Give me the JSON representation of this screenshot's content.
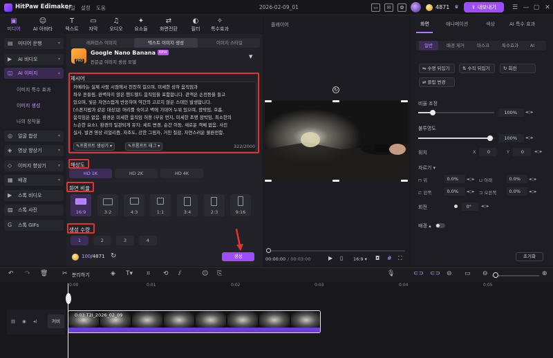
{
  "app": {
    "name": "HitPaw Edimakor",
    "project_name": "2026-02-09_01"
  },
  "menu": [
    "파일",
    "설정",
    "도움"
  ],
  "account": {
    "credits": "4871",
    "export_label": "내보내기"
  },
  "toolbar": [
    {
      "label": "미디어",
      "icon": "media-icon",
      "glyph": "▣"
    },
    {
      "label": "AI 아바타",
      "icon": "avatar-icon",
      "glyph": "☺"
    },
    {
      "label": "텍스트",
      "icon": "text-icon",
      "glyph": "T"
    },
    {
      "label": "자막",
      "icon": "subtitle-icon",
      "glyph": "▭"
    },
    {
      "label": "오디오",
      "icon": "audio-icon",
      "glyph": "♫"
    },
    {
      "label": "요소들",
      "icon": "elements-icon",
      "glyph": "✦"
    },
    {
      "label": "화면전환",
      "icon": "transition-icon",
      "glyph": "⇄"
    },
    {
      "label": "필터",
      "icon": "filter-icon",
      "glyph": "◐"
    },
    {
      "label": "특수효과",
      "icon": "effects-icon",
      "glyph": "✧"
    }
  ],
  "sidebar": {
    "items": [
      {
        "label": "미디어 운행",
        "icon": "folder-icon",
        "glyph": "▤",
        "arrow": "▾"
      },
      {
        "label": "AI 비디오",
        "icon": "ai-video-icon",
        "glyph": "▶",
        "arrow": "▾"
      },
      {
        "label": "AI 이미지",
        "icon": "ai-image-icon",
        "glyph": "◫",
        "arrow": "▴"
      }
    ],
    "subitems": [
      "이미지 특수 효과",
      "이미지 생성",
      "나의 창작물"
    ],
    "items2": [
      {
        "label": "얼굴 합성",
        "icon": "face-swap-icon",
        "glyph": "◎",
        "arrow": "▾"
      },
      {
        "label": "영상 향상기",
        "icon": "video-enhance-icon",
        "glyph": "◈",
        "arrow": "▾"
      },
      {
        "label": "이미지 향상기",
        "icon": "image-enhance-icon",
        "glyph": "◇",
        "arrow": "▾"
      },
      {
        "label": "배경",
        "icon": "background-icon",
        "glyph": "▦",
        "arrow": "▾"
      },
      {
        "label": "스톡 비디오",
        "icon": "stock-video-icon",
        "glyph": "▶"
      },
      {
        "label": "스톡 사진",
        "icon": "stock-photo-icon",
        "glyph": "▨"
      },
      {
        "label": "스톡 GIFs",
        "icon": "gif-icon",
        "glyph": "G"
      }
    ]
  },
  "gen_tabs": [
    "레퍼런스 이미지",
    "텍스트 이미지 생성",
    "이미지 스타일"
  ],
  "model": {
    "name": "Google Nano Banana Pro",
    "badge": "NEW",
    "desc": "전문급 이미지 생성 모델",
    "pro": "PRO"
  },
  "prompt": {
    "label": "제시어",
    "text": "카메라는 실제 사람 시점에서 천천히 걸으며, 미세한 상하 움직임과\n좌우 흔들림, 완벽하지 않은 핸드헬드 움직임을 포함합니다. 관객은 손전등을 들고\n있으며, 빛은 자연스럽게 반응하며 약간의 고르지 않은 스테인 발생합니다.\n[스폰지밥과 같은 대상]은 머리를 숙이고 벽에 기대어 누워 있으며, 깜박임, 호흡,\n움직임은 없음. 환경은 미세한 움직임 허용 (부유 먼지, 미세한 조명 깜박임, 최소한의\n느슨한 요소). 환경의 일관되게 유지: 세트 변경, 순간 이동, 새로운 객체 없음. 사진\n실사, 발견 영상 리얼리즘, 자조도, 강한 그림자, 거친 질감, 자연스러운 불완전함.",
    "chip1": "프롬프트 생성기 ▾",
    "chip2": "프롬프트 태그 ▾",
    "counter": "322/2000"
  },
  "resolution": {
    "label": "해상도",
    "options": [
      "HD 1K",
      "HD 2K",
      "HD 4K"
    ]
  },
  "aspect": {
    "label": "화면 비율",
    "options": [
      "16:9",
      "3:2",
      "4:3",
      "1:1",
      "3:4",
      "2:3",
      "9:16"
    ]
  },
  "count": {
    "label": "생성 수량",
    "options": [
      "1",
      "2",
      "3",
      "4"
    ]
  },
  "bottom": {
    "credit_used": "100",
    "credit_total": "/4871",
    "generate_label": "생성"
  },
  "player": {
    "title": "플레이어",
    "time_current": "00:00:00",
    "time_total": "/ 00:03:00",
    "ratio": "16:9 ▾"
  },
  "props": {
    "tabs": [
      "화면",
      "애니메이션",
      "색상",
      "AI 특수 효과"
    ],
    "subtabs": [
      "일반",
      "배경 제거",
      "마스크",
      "특수효과",
      "AI"
    ],
    "flip_h": "수평 뒤집기",
    "flip_v": "수직 뒤집기",
    "rotate": "회전",
    "clip_change": "클립 변경",
    "scale_label": "비율 조정",
    "scale_value": "100%",
    "opacity_label": "불투명도",
    "opacity_value": "100%",
    "position_label": "위치",
    "pos_x_label": "X",
    "pos_x": "0",
    "pos_y_label": "Y",
    "pos_y": "0",
    "crop_label": "자르기 ▾",
    "crop_top": "위",
    "crop_bottom": "아래",
    "crop_left": "왼쪽",
    "crop_right": "오른쪽",
    "crop_val": "0.0%",
    "rotation_label": "회전",
    "rotation_value": "0°",
    "bg_label": "배경 ▴",
    "reset": "초기화"
  },
  "timeline": {
    "split_label": "분리하기",
    "ticks": [
      "0:00",
      "0:01",
      "0:02",
      "0:03",
      "0:04",
      "0:05"
    ],
    "cover": "커버",
    "clip_name": "0:03  T2I_2026_02_09"
  }
}
